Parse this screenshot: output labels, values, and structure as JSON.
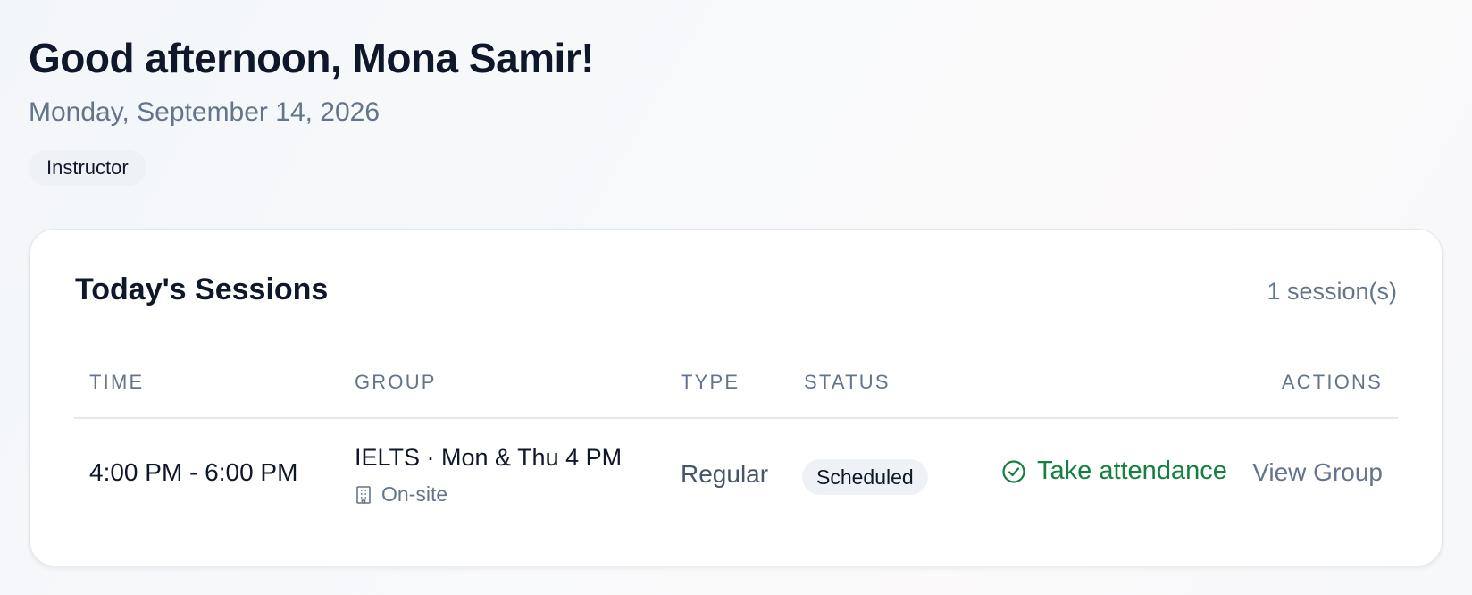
{
  "header": {
    "greeting": "Good afternoon, Mona Samir!",
    "date": "Monday, September 14, 2026",
    "role": "Instructor"
  },
  "sessions": {
    "title": "Today's Sessions",
    "count_label": "1 session(s)",
    "columns": {
      "time": "TIME",
      "group": "GROUP",
      "type": "TYPE",
      "status": "STATUS",
      "actions": "ACTIONS"
    },
    "rows": [
      {
        "time": "4:00 PM - 6:00 PM",
        "group": "IELTS · Mon & Thu 4 PM",
        "mode": "On-site",
        "mode_icon": "building-icon",
        "type": "Regular",
        "status": "Scheduled",
        "take_attendance": "Take attendance",
        "take_attendance_icon": "check-circle-icon",
        "view_group": "View Group"
      }
    ]
  },
  "colors": {
    "primary_text": "#0f172a",
    "muted_text": "#64748b",
    "success": "#15803d",
    "badge_bg": "#eef1f5"
  }
}
